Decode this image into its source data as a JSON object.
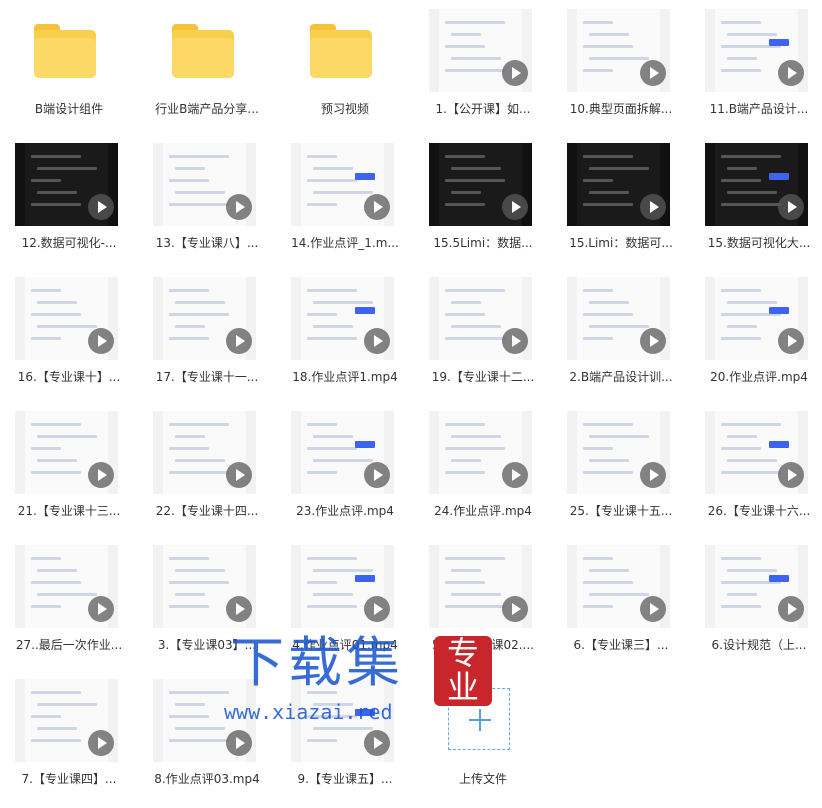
{
  "items": [
    {
      "kind": "folder",
      "label": "B端设计组件"
    },
    {
      "kind": "folder",
      "label": "行业B端产品分享..."
    },
    {
      "kind": "folder",
      "label": "预习视频"
    },
    {
      "kind": "video",
      "label": "1.【公开课】如...",
      "theme": "light"
    },
    {
      "kind": "video",
      "label": "10.典型页面拆解...",
      "theme": "light"
    },
    {
      "kind": "video",
      "label": "11.B端产品设计...",
      "theme": "light"
    },
    {
      "kind": "video",
      "label": "12.数据可视化-...",
      "theme": "dark"
    },
    {
      "kind": "video",
      "label": "13.【专业课八】...",
      "theme": "light"
    },
    {
      "kind": "video",
      "label": "14.作业点评_1.m...",
      "theme": "light"
    },
    {
      "kind": "video",
      "label": "15.5Limi：数据...",
      "theme": "dark"
    },
    {
      "kind": "video",
      "label": "15.Limi：数据可...",
      "theme": "dark"
    },
    {
      "kind": "video",
      "label": "15.数据可视化大...",
      "theme": "dark"
    },
    {
      "kind": "video",
      "label": "16.【专业课十】...",
      "theme": "light"
    },
    {
      "kind": "video",
      "label": "17.【专业课十一...",
      "theme": "light"
    },
    {
      "kind": "video",
      "label": "18.作业点评1.mp4",
      "theme": "light"
    },
    {
      "kind": "video",
      "label": "19.【专业课十二...",
      "theme": "light"
    },
    {
      "kind": "video",
      "label": "2.B端产品设计训...",
      "theme": "light"
    },
    {
      "kind": "video",
      "label": "20.作业点评.mp4",
      "theme": "light"
    },
    {
      "kind": "video",
      "label": "21.【专业课十三...",
      "theme": "light"
    },
    {
      "kind": "video",
      "label": "22.【专业课十四...",
      "theme": "light"
    },
    {
      "kind": "video",
      "label": "23.作业点评.mp4",
      "theme": "light"
    },
    {
      "kind": "video",
      "label": "24.作业点评.mp4",
      "theme": "light"
    },
    {
      "kind": "video",
      "label": "25.【专业课十五...",
      "theme": "light"
    },
    {
      "kind": "video",
      "label": "26.【专业课十六...",
      "theme": "light"
    },
    {
      "kind": "video",
      "label": "27..最后一次作业...",
      "theme": "light"
    },
    {
      "kind": "video",
      "label": "3.【专业课03】...",
      "theme": "light"
    },
    {
      "kind": "video",
      "label": "4.作业点评01.mp4",
      "theme": "light"
    },
    {
      "kind": "video",
      "label": "5.作业点评课02....",
      "theme": "light"
    },
    {
      "kind": "video",
      "label": "6.【专业课三】...",
      "theme": "light"
    },
    {
      "kind": "video",
      "label": "6.设计规范（上...",
      "theme": "light"
    },
    {
      "kind": "video",
      "label": "7.【专业课四】...",
      "theme": "light"
    },
    {
      "kind": "video",
      "label": "8.作业点评03.mp4",
      "theme": "light"
    },
    {
      "kind": "video",
      "label": "9.【专业课五】...",
      "theme": "light"
    },
    {
      "kind": "upload",
      "label": "上传文件"
    }
  ],
  "watermark": {
    "text": "下载集",
    "seal": "专业",
    "url": "www.xiazai.red"
  },
  "colors": {
    "folder": "#f9cf4b",
    "accent": "#3c64f0",
    "watermark": "#1b58ce",
    "seal": "#c8262b",
    "upload_border": "#6aa6e8"
  }
}
